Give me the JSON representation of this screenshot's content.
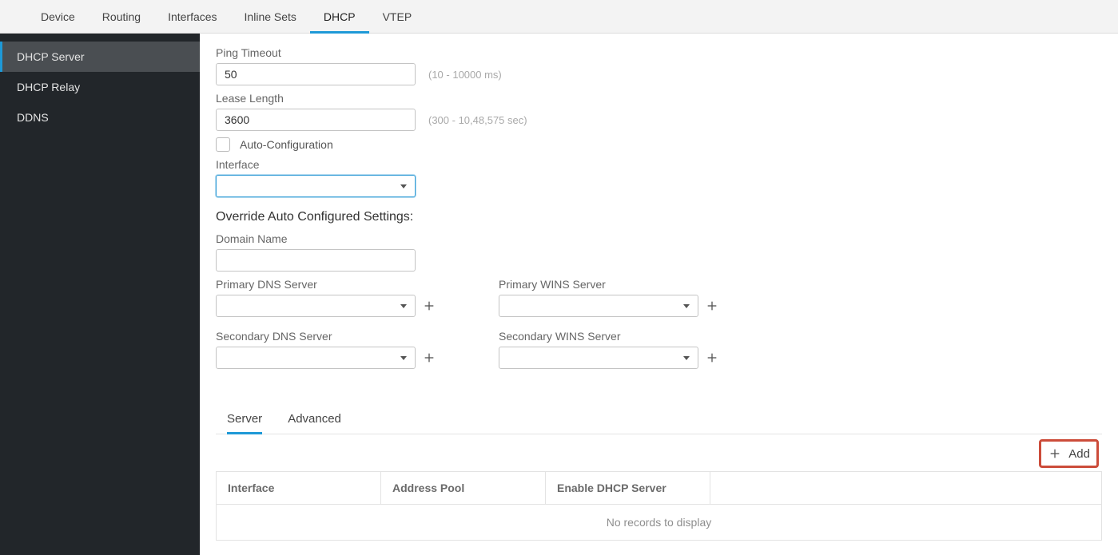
{
  "topTabs": {
    "device": "Device",
    "routing": "Routing",
    "interfaces": "Interfaces",
    "inlineSets": "Inline Sets",
    "dhcp": "DHCP",
    "vtep": "VTEP"
  },
  "sidebar": {
    "dhcpServer": "DHCP Server",
    "dhcpRelay": "DHCP Relay",
    "ddns": "DDNS"
  },
  "form": {
    "pingTimeoutLabel": "Ping Timeout",
    "pingTimeoutValue": "50",
    "pingTimeoutHint": "(10 - 10000 ms)",
    "leaseLengthLabel": "Lease Length",
    "leaseLengthValue": "3600",
    "leaseLengthHint": "(300 - 10,48,575 sec)",
    "autoConfigLabel": "Auto-Configuration",
    "interfaceLabel": "Interface",
    "interfaceValue": "",
    "overrideTitle": "Override Auto Configured Settings:",
    "domainNameLabel": "Domain Name",
    "domainNameValue": "",
    "primaryDnsLabel": "Primary DNS Server",
    "primaryDnsValue": "",
    "secondaryDnsLabel": "Secondary DNS Server",
    "secondaryDnsValue": "",
    "primaryWinsLabel": "Primary WINS Server",
    "primaryWinsValue": "",
    "secondaryWinsLabel": "Secondary WINS Server",
    "secondaryWinsValue": ""
  },
  "subTabs": {
    "server": "Server",
    "advanced": "Advanced"
  },
  "addButton": "Add",
  "table": {
    "cols": {
      "interface": "Interface",
      "addressPool": "Address Pool",
      "enableDhcp": "Enable DHCP Server"
    },
    "empty": "No records to display"
  }
}
